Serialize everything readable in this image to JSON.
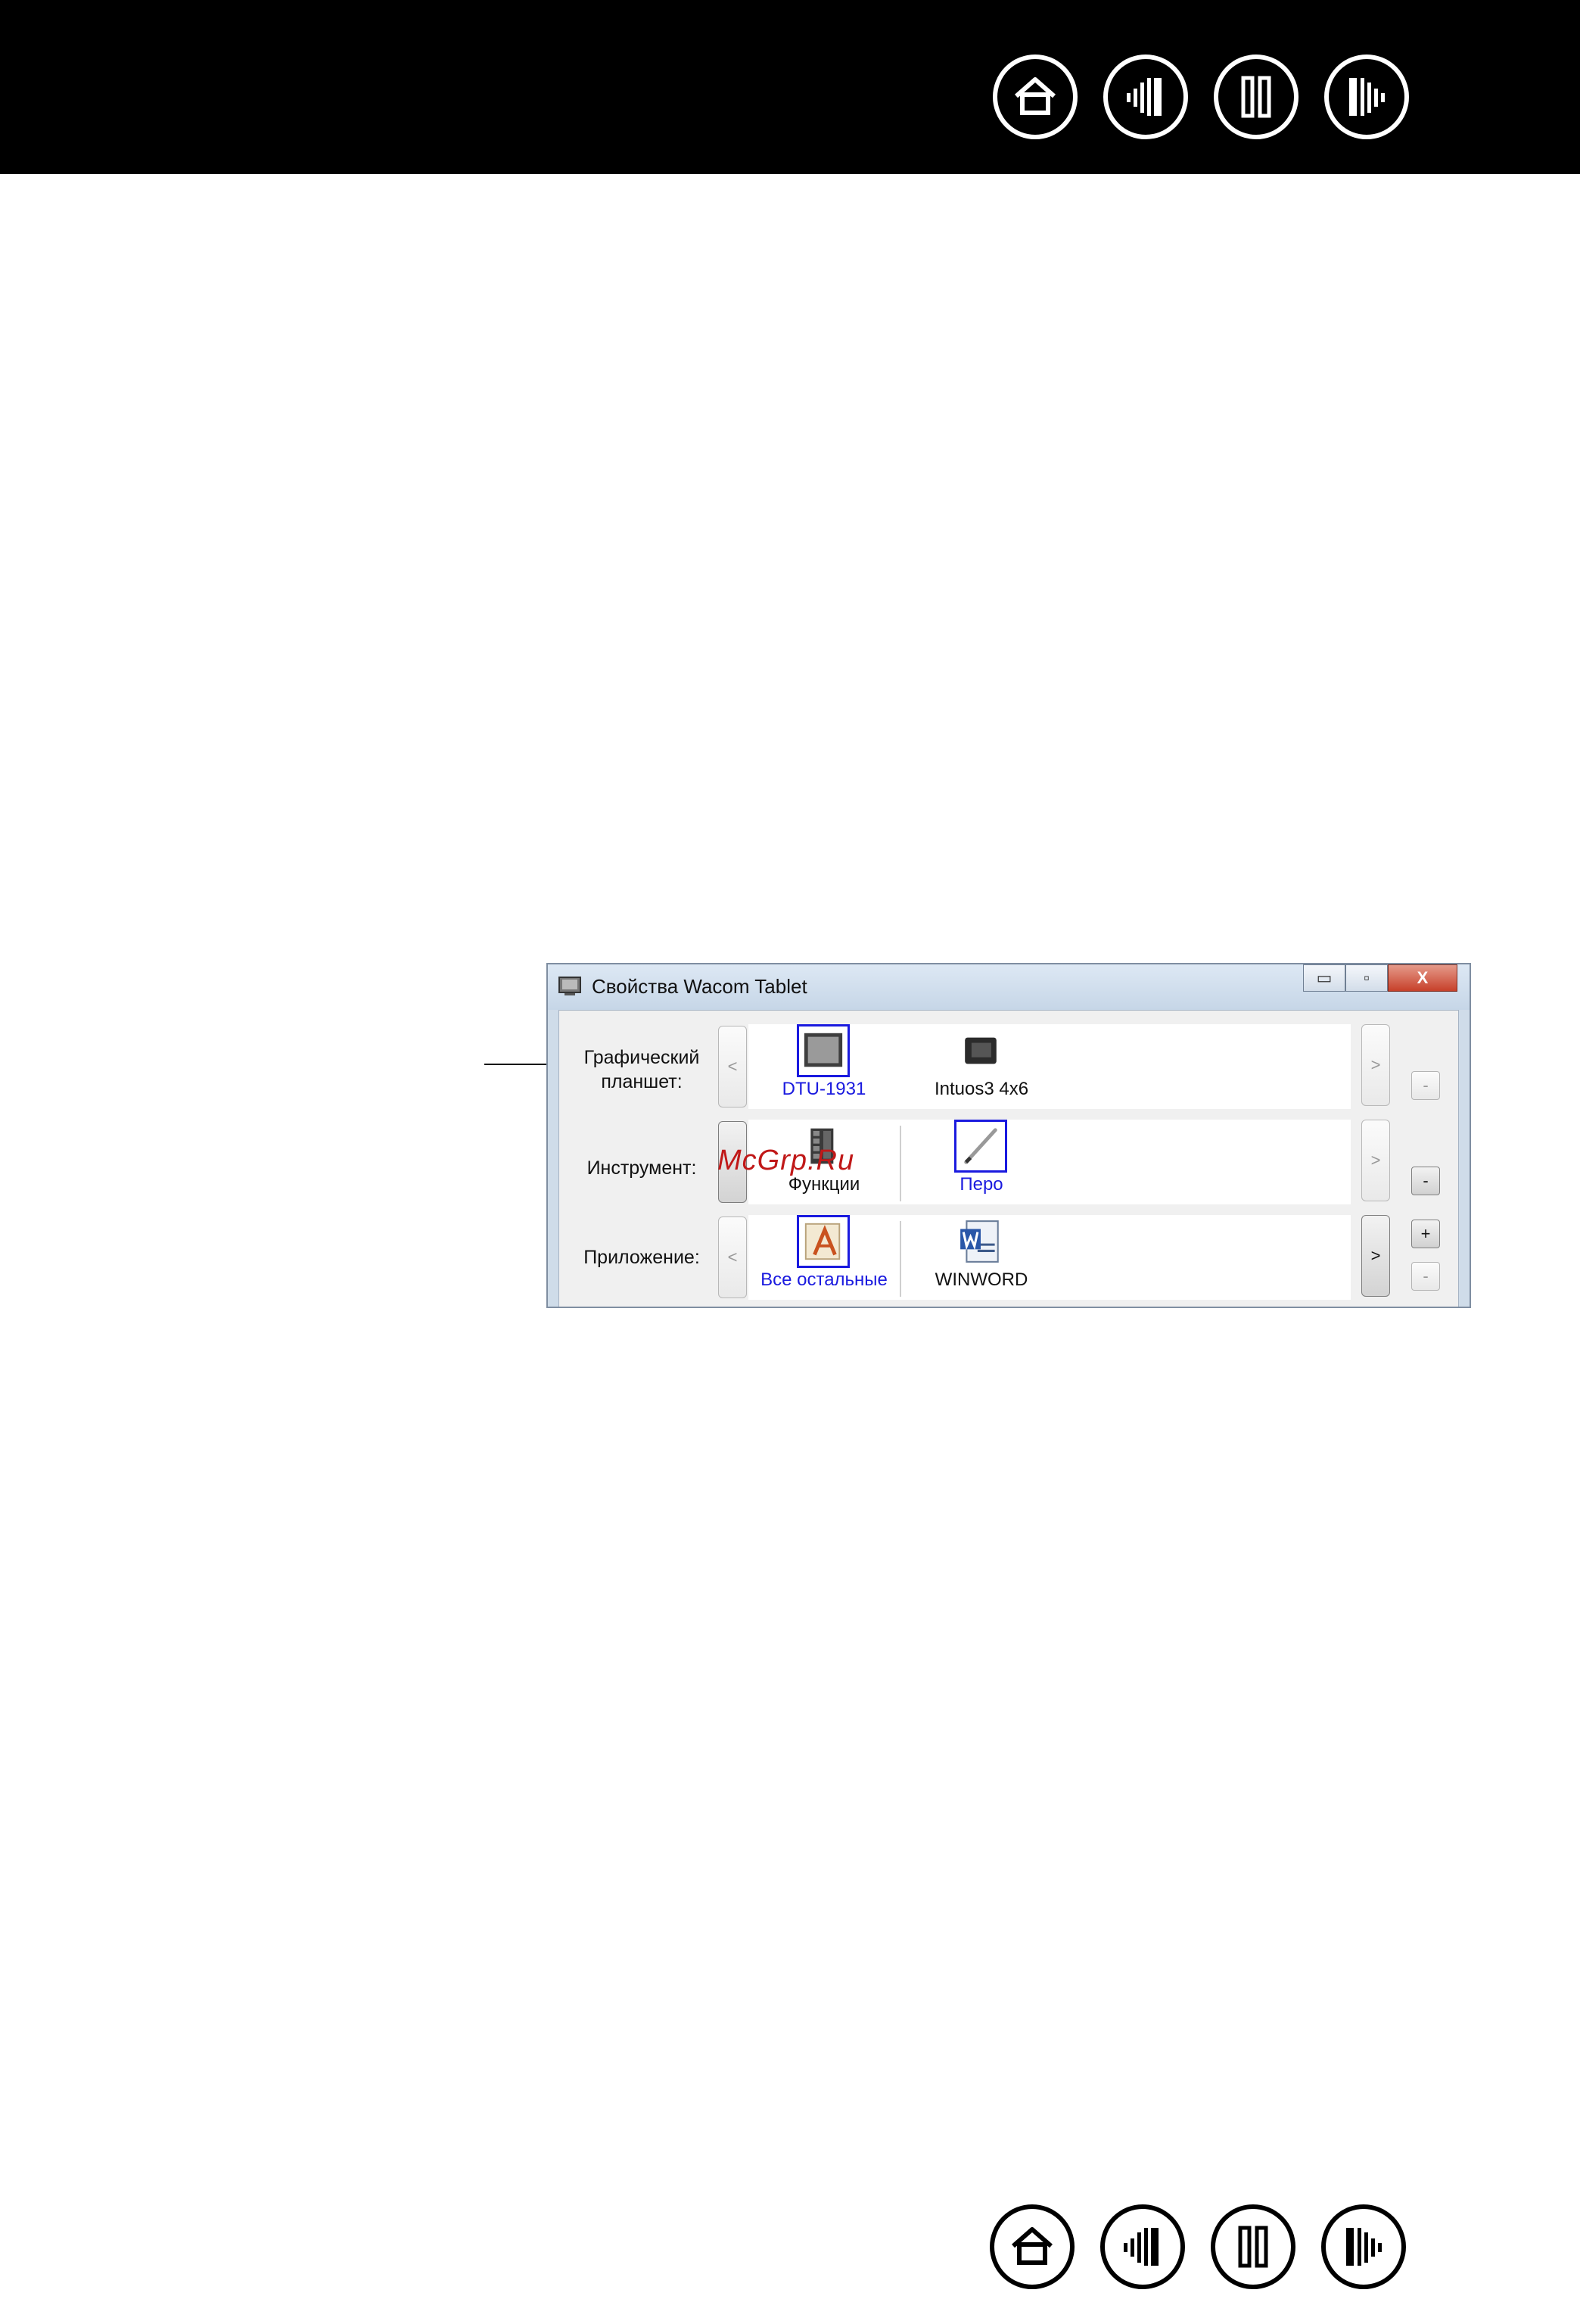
{
  "nav": {
    "icons": [
      "home-icon",
      "contents-icon",
      "index-icon",
      "next-section-icon"
    ]
  },
  "window": {
    "title": "Свойства Wacom Tablet",
    "minimize": "▭",
    "maximize": "▫",
    "close": "X"
  },
  "rows": {
    "tablet": {
      "label_line1": "Графический",
      "label_line2": "планшет:",
      "prev": "<",
      "next": ">",
      "remove": "-",
      "items": [
        {
          "label": "DTU-1931",
          "selected": true
        },
        {
          "label": "Intuos3 4x6",
          "selected": false
        }
      ]
    },
    "tool": {
      "label": "Инструмент:",
      "next": ">",
      "remove": "-",
      "items": [
        {
          "label": "Функции",
          "selected": false
        },
        {
          "label": "Перо",
          "selected": true
        }
      ]
    },
    "app": {
      "label": "Приложение:",
      "prev": "<",
      "next": ">",
      "add": "+",
      "remove": "-",
      "items": [
        {
          "label": "Все остальные",
          "selected": true
        },
        {
          "label": "WINWORD",
          "selected": false
        }
      ]
    }
  },
  "watermark": "McGrp.Ru",
  "colors": {
    "selection": "#1a1adf",
    "watermark": "#c01818",
    "header": "#000000"
  }
}
